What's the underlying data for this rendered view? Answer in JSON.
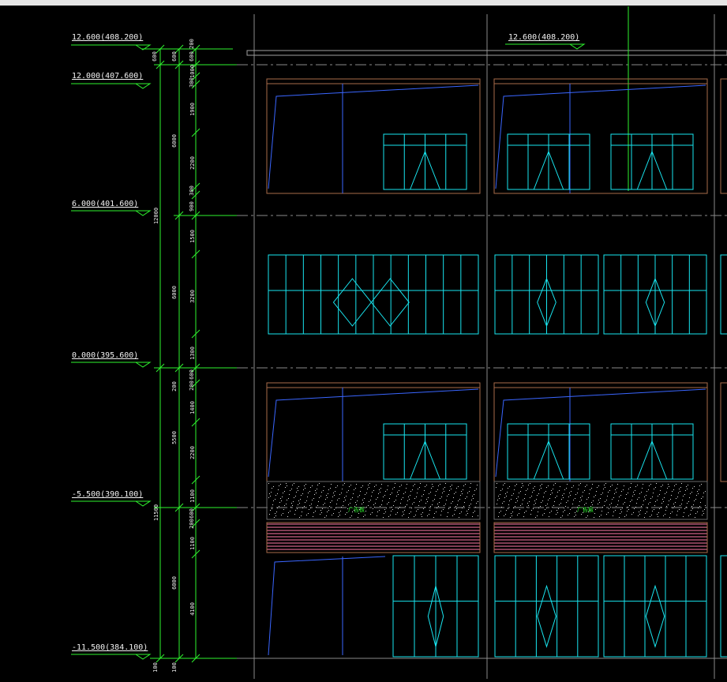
{
  "elevations": {
    "top_left": "12.600(408.200)",
    "top_right": "12.600(408.200)",
    "l12": "12.000(407.600)",
    "l6": "6.000(401.600)",
    "l0": "0.000(395.600)",
    "lm55": "-5.500(390.100)",
    "lm115": "-11.500(384.100)"
  },
  "dims_outer": {
    "d600": "600",
    "d12000": "12000",
    "d11500": "11500"
  },
  "dims_middle": {
    "d600": "600",
    "d6000a": "6000",
    "d6000b": "6000",
    "d5500": "5500",
    "d6000c": "6000",
    "d200": "200"
  },
  "dims_inner": {
    "a200": "200",
    "a600": "600",
    "a1000": "1000",
    "a300": "300",
    "a1900": "1900",
    "a2200": "2200",
    "a300b": "300",
    "a200b": "200",
    "b900": "900",
    "b1500": "1500",
    "b3200": "3200",
    "b1300": "1300",
    "c600": "600",
    "c200": "200",
    "c1400": "1400",
    "c2200": "2200",
    "c1100": "1100",
    "d600": "600",
    "d200": "200",
    "d1100": "1100",
    "d4100": "4100"
  },
  "bottom_dims": {
    "b1": "100",
    "b2": "100"
  },
  "section_tags": [
    "广告板",
    "广告板"
  ],
  "colors": {
    "green": "#2ef52e",
    "cyan": "#19e6f0",
    "brown": "#a86b4a",
    "blue": "#3a66ff",
    "grid": "#8a8a8a",
    "pink": "#ff7aa8"
  }
}
